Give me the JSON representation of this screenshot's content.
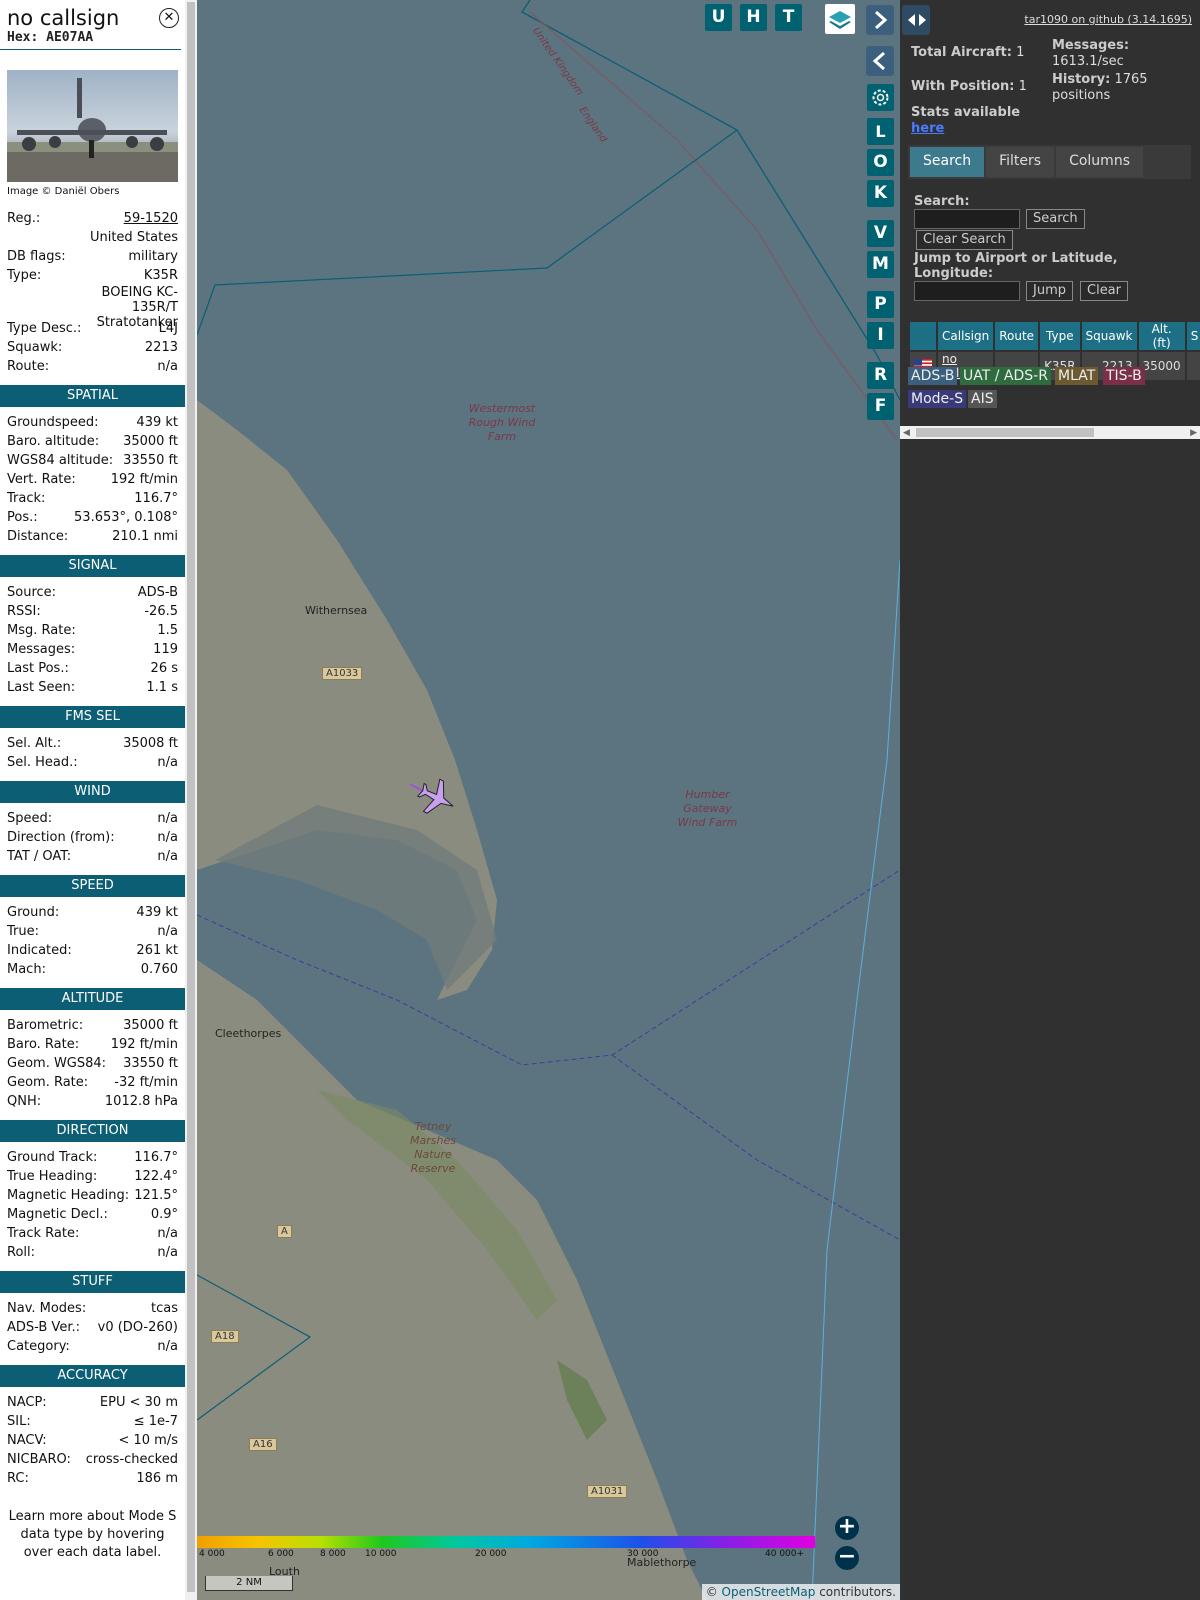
{
  "aircraft": {
    "callsign": "no callsign",
    "hex": "Hex: AE07AA",
    "photo_credit": "Image © Daniël Obers",
    "basic": [
      {
        "label": "Reg.:",
        "value": "59-1520"
      },
      {
        "label": "",
        "value": "United States"
      },
      {
        "label": "DB flags:",
        "value": "military"
      },
      {
        "label": "Type:",
        "value": "K35R"
      },
      {
        "label": "",
        "value": "BOEING KC-135R/T Stratotanker"
      },
      {
        "label": "Type Desc.:",
        "value": "L4J"
      },
      {
        "label": "Squawk:",
        "value": "2213"
      },
      {
        "label": "Route:",
        "value": "n/a"
      }
    ]
  },
  "sections": {
    "spatial": {
      "title": "SPATIAL",
      "rows": [
        {
          "label": "Groundspeed:",
          "value": "439 kt"
        },
        {
          "label": "Baro. altitude:",
          "value": "35000 ft"
        },
        {
          "label": "WGS84 altitude:",
          "value": "33550 ft"
        },
        {
          "label": "Vert. Rate:",
          "value": "192 ft/min"
        },
        {
          "label": "Track:",
          "value": "116.7°"
        },
        {
          "label": "Pos.:",
          "value": "53.653°, 0.108°"
        },
        {
          "label": "Distance:",
          "value": "210.1 nmi"
        }
      ]
    },
    "signal": {
      "title": "SIGNAL",
      "rows": [
        {
          "label": "Source:",
          "value": "ADS-B"
        },
        {
          "label": "RSSI:",
          "value": "-26.5"
        },
        {
          "label": "Msg. Rate:",
          "value": "1.5"
        },
        {
          "label": "Messages:",
          "value": "119"
        },
        {
          "label": "Last Pos.:",
          "value": "26 s"
        },
        {
          "label": "Last Seen:",
          "value": "1.1 s"
        }
      ]
    },
    "fms": {
      "title": "FMS SEL",
      "rows": [
        {
          "label": "Sel. Alt.:",
          "value": "35008 ft"
        },
        {
          "label": "Sel. Head.:",
          "value": "n/a"
        }
      ]
    },
    "wind": {
      "title": "WIND",
      "rows": [
        {
          "label": "Speed:",
          "value": "n/a"
        },
        {
          "label": "Direction (from):",
          "value": "n/a"
        },
        {
          "label": "TAT / OAT:",
          "value": "n/a"
        }
      ]
    },
    "speed": {
      "title": "SPEED",
      "rows": [
        {
          "label": "Ground:",
          "value": "439 kt"
        },
        {
          "label": "True:",
          "value": "n/a"
        },
        {
          "label": "Indicated:",
          "value": "261 kt"
        },
        {
          "label": "Mach:",
          "value": "0.760"
        }
      ]
    },
    "altitude": {
      "title": "ALTITUDE",
      "rows": [
        {
          "label": "Barometric:",
          "value": "35000 ft"
        },
        {
          "label": "Baro. Rate:",
          "value": "192 ft/min"
        },
        {
          "label": "Geom. WGS84:",
          "value": "33550 ft"
        },
        {
          "label": "Geom. Rate:",
          "value": "-32 ft/min"
        },
        {
          "label": "QNH:",
          "value": "1012.8 hPa"
        }
      ]
    },
    "direction": {
      "title": "DIRECTION",
      "rows": [
        {
          "label": "Ground Track:",
          "value": "116.7°"
        },
        {
          "label": "True Heading:",
          "value": "122.4°"
        },
        {
          "label": "Magnetic Heading:",
          "value": "121.5°"
        },
        {
          "label": "Magnetic Decl.:",
          "value": "0.9°"
        },
        {
          "label": "Track Rate:",
          "value": "n/a"
        },
        {
          "label": "Roll:",
          "value": "n/a"
        }
      ]
    },
    "stuff": {
      "title": "STUFF",
      "rows": [
        {
          "label": "Nav. Modes:",
          "value": "tcas"
        },
        {
          "label": "ADS-B Ver.:",
          "value": "v0 (DO-260)"
        },
        {
          "label": "Category:",
          "value": "n/a"
        }
      ]
    },
    "accuracy": {
      "title": "ACCURACY",
      "rows": [
        {
          "label": "NACP:",
          "value": "EPU < 30 m"
        },
        {
          "label": "SIL:",
          "value": "≤ 1e-7"
        },
        {
          "label": "NACV:",
          "value": "< 10 m/s"
        },
        {
          "label": "NICBARO:",
          "value": "cross-checked"
        },
        {
          "label": "RC:",
          "value": "186 m"
        }
      ]
    }
  },
  "learn_more": "Learn more about Mode S data type by hovering over each data label.",
  "map": {
    "labels": {
      "witherness": "Withernsea",
      "cleethorpes": "Cleethorpes",
      "louth": "Louth",
      "mablethorpe": "Mablethorpe",
      "westermost": "Westermost Rough Wind Farm",
      "humber": "Humber Gateway Wind Farm",
      "tetney": "Tetney Marshes Nature Reserve",
      "uk": "United Kingdom",
      "england": "England"
    },
    "roads": {
      "a1033": "A1033",
      "a": "A",
      "a18": "A18",
      "a16": "A16",
      "a1031": "A1031"
    },
    "buttons": {
      "u": "U",
      "h": "H",
      "t": "T",
      "l": "L",
      "o": "O",
      "k": "K",
      "v": "V",
      "m": "M",
      "p": "P",
      "i": "I",
      "r": "R",
      "f": "F"
    },
    "zoom_in": "+",
    "zoom_out": "−",
    "altitude_ticks": [
      "4 000",
      "6 000",
      "8 000",
      "10 000",
      "20 000",
      "30 000",
      "40 000+"
    ],
    "scale": "2 NM",
    "attribution_prefix": "© ",
    "attribution_link": "OpenStreetMap",
    "attribution_suffix": " contributors."
  },
  "right": {
    "version": "tar1090 on github (3.14.1695)",
    "total_aircraft_label": "Total Aircraft:",
    "total_aircraft": "1",
    "with_position_label": "With Position:",
    "with_position": "1",
    "stats_label": "Stats available",
    "stats_link": "here",
    "messages_label": "Messages:",
    "messages_value": "1613.1/sec",
    "history_label": "History:",
    "history_value": "1765 positions",
    "tabs": [
      "Search",
      "Filters",
      "Columns"
    ],
    "search_label": "Search:",
    "search_button": "Search",
    "clear_search": "Clear Search",
    "jump_label": "Jump to Airport or Latitude, Longitude:",
    "jump_button": "Jump",
    "clear_button": "Clear",
    "table": {
      "headers": [
        "",
        "Callsign",
        "Route",
        "Type",
        "Squawk",
        "Alt. (ft)",
        "S"
      ],
      "row": {
        "callsign": "no callsign",
        "route": "",
        "type": "K35R",
        "squawk": "2213",
        "alt": "35000"
      }
    },
    "sources": [
      "ADS-B",
      "UAT / ADS-R",
      "MLAT",
      "TIS-B",
      "Mode-S",
      "AIS"
    ],
    "source_colors": [
      "#3b5f7d",
      "#2e6b3e",
      "#6b5a30",
      "#7a2e48",
      "#3a3a7a",
      "#555555"
    ]
  }
}
